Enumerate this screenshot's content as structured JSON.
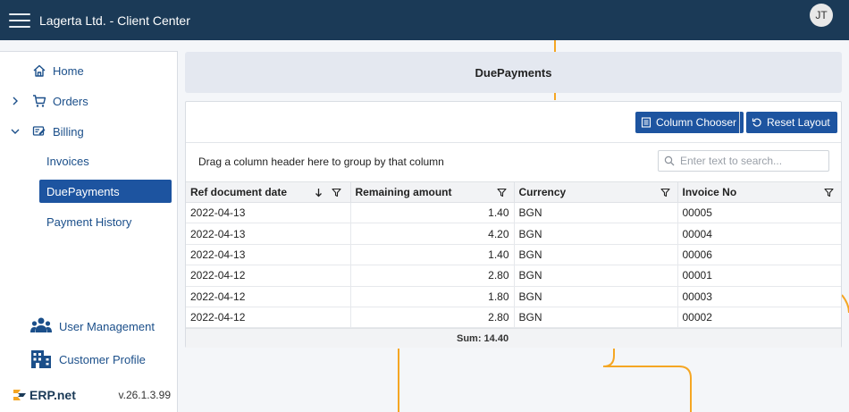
{
  "header": {
    "title": "Lagerta Ltd. - Client Center",
    "avatar_initials": "JT"
  },
  "sidebar": {
    "items": [
      {
        "label": "Home",
        "icon": "home-icon"
      },
      {
        "label": "Orders",
        "icon": "cart-icon"
      },
      {
        "label": "Billing",
        "icon": "billing-icon"
      }
    ],
    "billing_sub": [
      {
        "label": "Invoices"
      },
      {
        "label": "DuePayments",
        "active": true
      },
      {
        "label": "Payment History"
      }
    ],
    "bottom": [
      {
        "label": "User Management",
        "icon": "users-icon"
      },
      {
        "label": "Customer Profile",
        "icon": "building-icon"
      }
    ],
    "brand": "ERP.net",
    "version": "v.26.1.3.99"
  },
  "page": {
    "title": "DuePayments"
  },
  "toolbar": {
    "column_chooser_label": "Column Chooser",
    "reset_layout_label": "Reset Layout"
  },
  "grid": {
    "group_hint": "Drag a column header here to group by that column",
    "search_placeholder": "Enter text to search...",
    "columns": [
      "Ref document date",
      "Remaining amount",
      "Currency",
      "Invoice No"
    ],
    "rows": [
      [
        "2022-04-13",
        "1.40",
        "BGN",
        "00005"
      ],
      [
        "2022-04-13",
        "4.20",
        "BGN",
        "00004"
      ],
      [
        "2022-04-13",
        "1.40",
        "BGN",
        "00006"
      ],
      [
        "2022-04-12",
        "2.80",
        "BGN",
        "00001"
      ],
      [
        "2022-04-12",
        "1.80",
        "BGN",
        "00003"
      ],
      [
        "2022-04-12",
        "2.80",
        "BGN",
        "00002"
      ]
    ],
    "sum_label": "Sum: 14.40"
  },
  "colors": {
    "header_bg": "#1b3a57",
    "accent": "#1d54a0",
    "deco_line": "#f5a623"
  }
}
